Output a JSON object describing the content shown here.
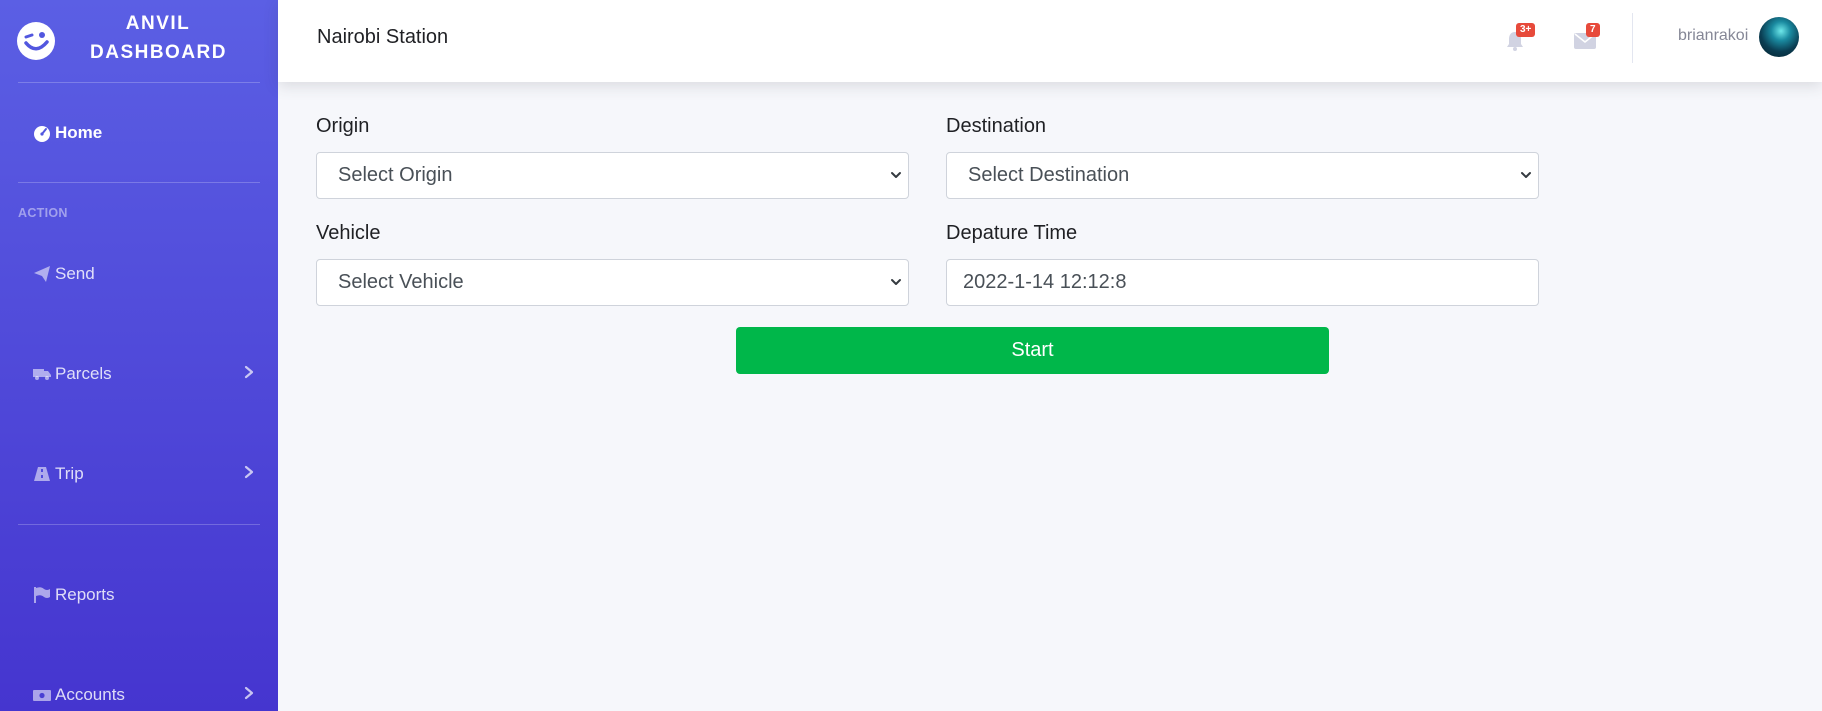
{
  "sidebar": {
    "brand_line1": "ANVIL",
    "brand_line2": "DASHBOARD",
    "section_action": "ACTION",
    "items": [
      {
        "label": "Home"
      },
      {
        "label": "Send"
      },
      {
        "label": "Parcels"
      },
      {
        "label": "Trip"
      },
      {
        "label": "Reports"
      },
      {
        "label": "Accounts"
      }
    ]
  },
  "topbar": {
    "station": "Nairobi Station",
    "alerts_badge": "3+",
    "messages_badge": "7",
    "username": "brianrakoi"
  },
  "form": {
    "origin_label": "Origin",
    "origin_value": "Select Origin",
    "destination_label": "Destination",
    "destination_value": "Select Destination",
    "vehicle_label": "Vehicle",
    "vehicle_value": "Select Vehicle",
    "departure_label": "Depature Time",
    "departure_value": "2022-1-14 12:12:8",
    "start_label": "Start"
  },
  "colors": {
    "sidebar_top": "#5b5fe4",
    "sidebar_bottom": "#4535cf",
    "start_button": "#00b74a",
    "badge": "#e74a3b"
  }
}
